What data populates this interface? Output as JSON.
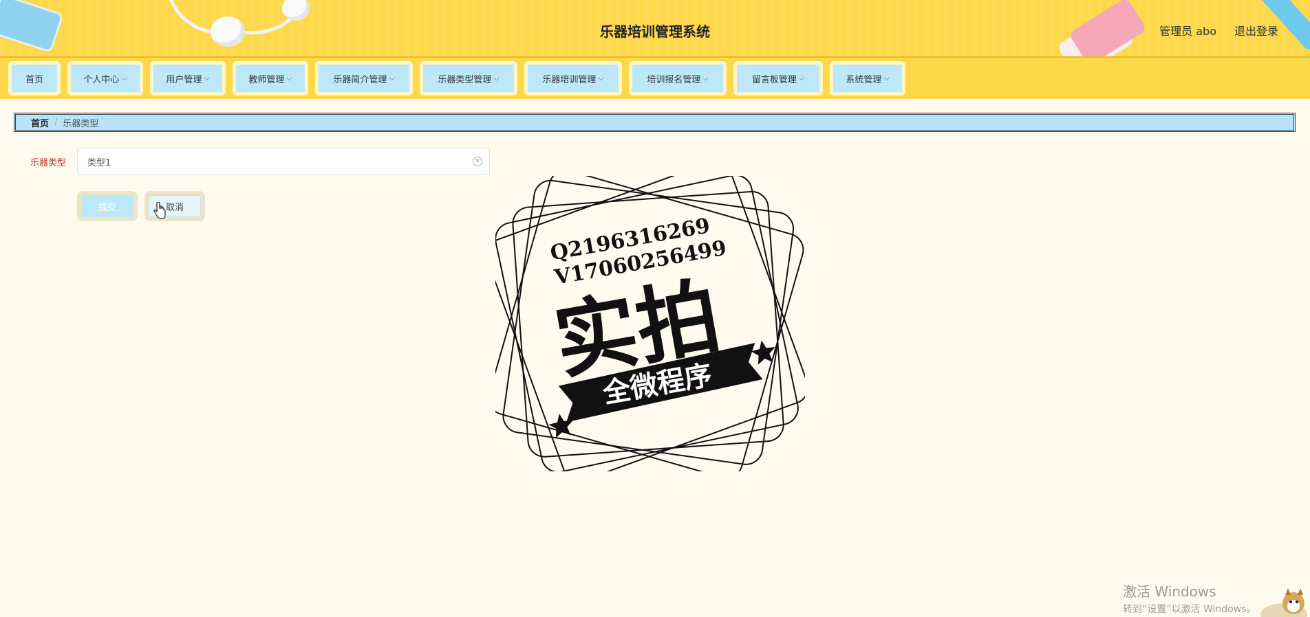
{
  "header": {
    "title": "乐器培训管理系统",
    "user_label": "管理员 abo",
    "logout_label": "退出登录"
  },
  "nav": [
    {
      "label": "首页",
      "has_dropdown": false
    },
    {
      "label": "个人中心",
      "has_dropdown": true
    },
    {
      "label": "用户管理",
      "has_dropdown": true
    },
    {
      "label": "教师管理",
      "has_dropdown": true
    },
    {
      "label": "乐器简介管理",
      "has_dropdown": true
    },
    {
      "label": "乐器类型管理",
      "has_dropdown": true
    },
    {
      "label": "乐器培训管理",
      "has_dropdown": true
    },
    {
      "label": "培训报名管理",
      "has_dropdown": true
    },
    {
      "label": "留言板管理",
      "has_dropdown": true
    },
    {
      "label": "系统管理",
      "has_dropdown": true
    }
  ],
  "breadcrumb": {
    "home": "首页",
    "separator": "/",
    "current": "乐器类型"
  },
  "form": {
    "field_label": "乐器类型",
    "field_value": "类型1",
    "submit_label": "提交",
    "cancel_label": "取消"
  },
  "watermark": {
    "line1": "Q2196316269",
    "line2": "V17060256499",
    "main": "实拍",
    "banner": "全微程序"
  },
  "windows_activation": {
    "title": "激活 Windows",
    "subtitle": "转到“设置”以激活 Windows。"
  },
  "colors": {
    "header_bg": "#fdd84a",
    "nav_item_bg": "#bde8fa",
    "page_bg": "#fefbee",
    "label_red": "#b8332a"
  }
}
